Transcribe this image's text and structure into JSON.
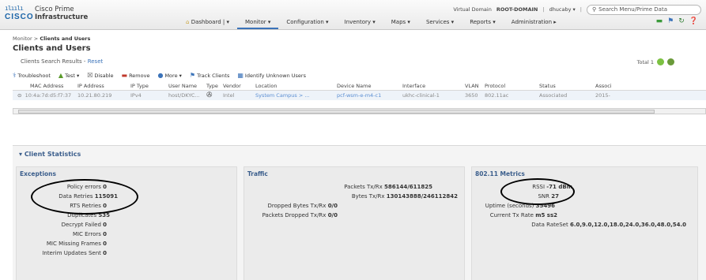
{
  "header": {
    "logo_bars": "ılıılı",
    "logo_cisco": "CISCO",
    "product_line1": "Cisco Prime",
    "product_line2": "Infrastructure",
    "virtual_domain_label": "Virtual Domain",
    "virtual_domain_value": "ROOT-DOMAIN",
    "user": "dhucaby ▾",
    "search_placeholder": "Search Menu/Prime Data"
  },
  "nav": {
    "dashboard": "Dashboard",
    "monitor": "Monitor ▾",
    "configuration": "Configuration ▾",
    "inventory": "Inventory ▾",
    "maps": "Maps ▾",
    "services": "Services ▾",
    "reports": "Reports ▾",
    "administration": "Administration ▸"
  },
  "breadcrumb": {
    "parent": "Monitor",
    "current": "Clients and Users"
  },
  "page_title": "Clients and Users",
  "results": {
    "label": "Clients Search Results -",
    "reset": "Reset",
    "total": "Total 1"
  },
  "toolbar": {
    "troubleshoot": "Troubleshoot",
    "test": "Test ▾",
    "disable": "Disable",
    "remove": "Remove",
    "more": "More ▾",
    "track_clients": "Track Clients",
    "identify_unknown": "Identify Unknown Users"
  },
  "table": {
    "headers": [
      "MAC Address",
      "IP Address",
      "IP Type",
      "User Name",
      "Type",
      "Vendor",
      "Location",
      "Device Name",
      "Interface",
      "VLAN",
      "Protocol",
      "Status",
      "Associ"
    ],
    "row": [
      "10:4a:7d:d5:f7:37",
      "10.21.80.219",
      "IPv4",
      "host/DKYC...",
      "",
      "Intel",
      "System Campus > ...",
      "pcf-wsm-e-m4-c1",
      "ukhc-clinical-1",
      "3650",
      "802.11ac",
      "Associated",
      "2015-"
    ]
  },
  "client_stats": {
    "title": "Client Statistics",
    "exceptions": {
      "title": "Exceptions",
      "items": [
        {
          "label": "Policy errors",
          "value": "0"
        },
        {
          "label": "Data Retries",
          "value": "115091"
        },
        {
          "label": "RTS Retries",
          "value": "0"
        },
        {
          "label": "Duplicates",
          "value": "535"
        },
        {
          "label": "Decrypt Failed",
          "value": "0"
        },
        {
          "label": "MIC Errors",
          "value": "0"
        },
        {
          "label": "MIC Missing Frames",
          "value": "0"
        },
        {
          "label": "Interim Updates Sent",
          "value": "0"
        }
      ]
    },
    "traffic": {
      "title": "Traffic",
      "items": [
        {
          "label": "Packets Tx/Rx",
          "value": "586144/611825"
        },
        {
          "label": "Bytes Tx/Rx",
          "value": "130143888/246112842"
        },
        {
          "label": "Dropped Bytes Tx/Rx",
          "value": "0/0"
        },
        {
          "label": "Packets Dropped Tx/Rx",
          "value": "0/0"
        }
      ]
    },
    "metrics": {
      "title": "802.11 Metrics",
      "items": [
        {
          "label": "RSSI",
          "value": "-71 dBm"
        },
        {
          "label": "SNR",
          "value": "27"
        },
        {
          "label": "Uptime (seconds)",
          "value": "35496"
        },
        {
          "label": "Current Tx Rate",
          "value": "m5 ss2"
        },
        {
          "label": "Data RateSet",
          "value": "6.0,9.0,12.0,18.0,24.0,36.0,48.0,54.0"
        }
      ]
    }
  },
  "colors": {
    "accent": "#3b73b9",
    "title_blue": "#3b5e8c",
    "row_bg": "#eef3f9"
  }
}
